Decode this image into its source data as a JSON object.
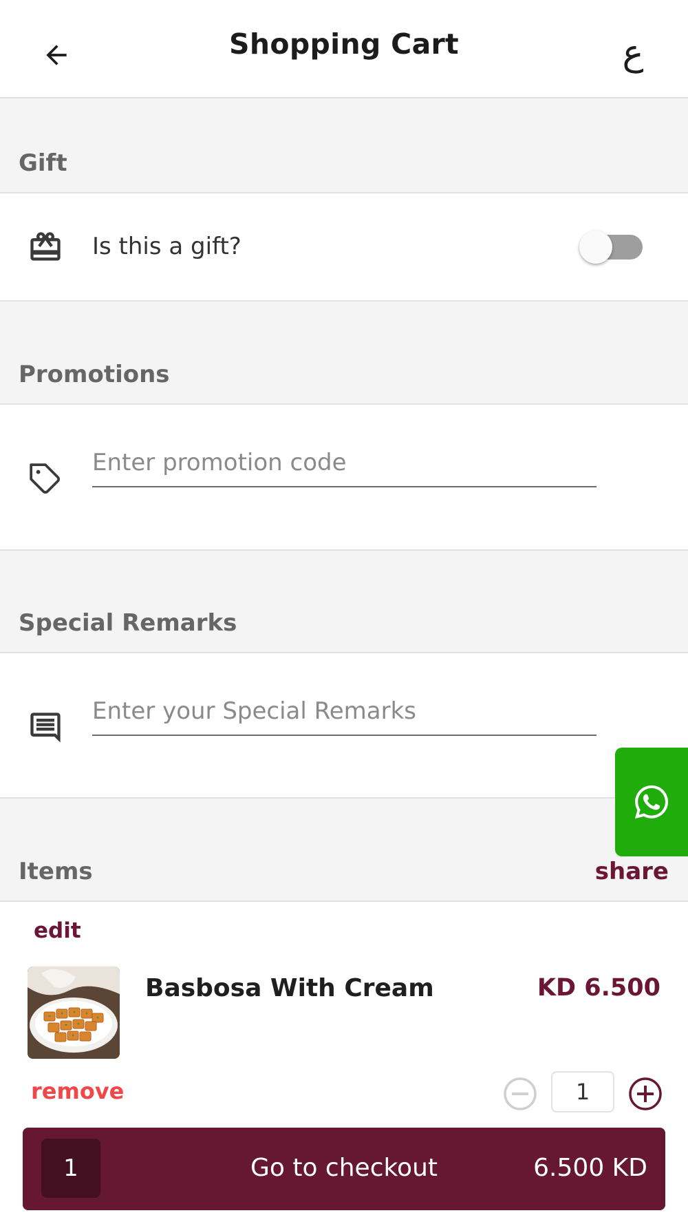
{
  "header": {
    "title": "Shopping Cart",
    "lang_toggle": "ع"
  },
  "gift": {
    "section_label": "Gift",
    "question": "Is this a gift?",
    "toggle_on": false
  },
  "promotions": {
    "section_label": "Promotions",
    "placeholder": "Enter promotion code",
    "value": ""
  },
  "remarks": {
    "section_label": "Special Remarks",
    "placeholder": "Enter your Special Remarks",
    "value": ""
  },
  "items": {
    "section_label": "Items",
    "share_label": "share",
    "list": [
      {
        "edit_label": "edit",
        "name": "Basbosa With Cream",
        "price": "KD 6.500",
        "remove_label": "remove",
        "quantity": "1"
      }
    ]
  },
  "checkout": {
    "count": "1",
    "label": "Go to checkout",
    "total": "6.500 KD"
  },
  "colors": {
    "brand": "#661833",
    "brand_dark": "#441021",
    "remove": "#f04848",
    "whatsapp": "#20ad0c"
  },
  "icons": {
    "back": "arrow-left-icon",
    "gift": "gift-icon",
    "promo": "tag-icon",
    "remarks": "message-icon",
    "whatsapp": "whatsapp-icon",
    "minus": "minus-circle-icon",
    "plus": "plus-circle-icon"
  }
}
